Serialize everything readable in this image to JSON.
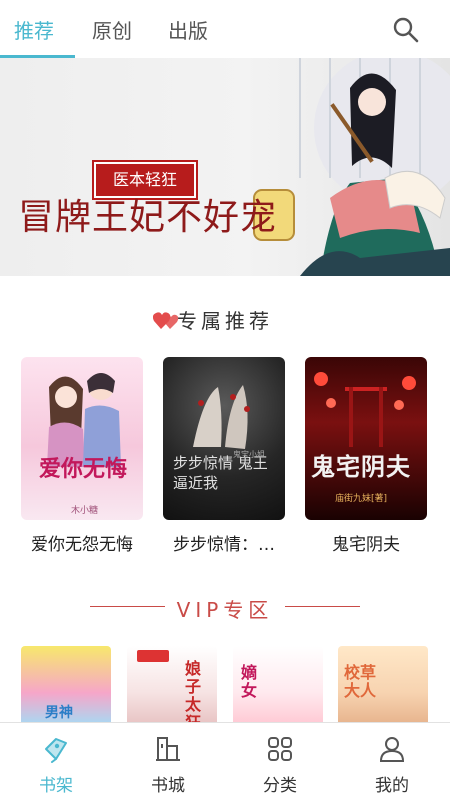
{
  "header": {
    "tabs": [
      {
        "label": "推荐",
        "active": true
      },
      {
        "label": "原创",
        "active": false
      },
      {
        "label": "出版",
        "active": false
      }
    ],
    "search_icon": "search-icon",
    "accent_color": "#4ab8cf"
  },
  "banner": {
    "author": "医本轻狂",
    "title": "冒牌王妃不好宠"
  },
  "recommend": {
    "title": "专属推荐",
    "icon": "hearts-icon",
    "books": [
      {
        "title": "爱你无怨无悔",
        "cover_text": "爱你无悔",
        "cover_author": "木小糖"
      },
      {
        "title": "步步惊情：…",
        "cover_text": "步步惊情 鬼王逼近我",
        "cover_author": "鬼宝小姐"
      },
      {
        "title": "鬼宅阴夫",
        "cover_text": "鬼宅阴夫",
        "cover_author": "庙街九妹[著]"
      }
    ]
  },
  "vip": {
    "title": "VIP专区",
    "covers": [
      {
        "cover_text": "男神"
      },
      {
        "cover_text": "娘子太狂"
      },
      {
        "cover_text": "嫡女"
      },
      {
        "cover_text": "校草大人"
      }
    ]
  },
  "bottom_nav": [
    {
      "label": "书架",
      "icon": "bookshelf-icon",
      "active": true
    },
    {
      "label": "书城",
      "icon": "bookstore-icon",
      "active": false
    },
    {
      "label": "分类",
      "icon": "category-icon",
      "active": false
    },
    {
      "label": "我的",
      "icon": "profile-icon",
      "active": false
    }
  ]
}
